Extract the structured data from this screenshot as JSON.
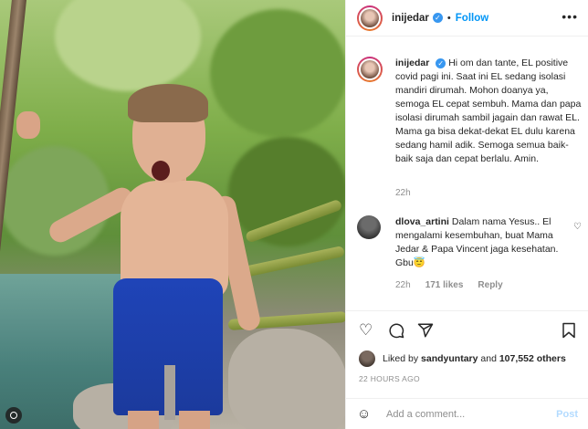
{
  "post": {
    "username": "inijedar",
    "follow_label": "Follow",
    "separator": "•",
    "more_label": "•••",
    "caption_user": "inijedar",
    "caption": "Hi om dan tante, EL positive covid pagi ini. Saat ini EL sedang isolasi mandiri dirumah. Mohon doanya ya, semoga EL cepat sembuh. Mama dan papa isolasi dirumah sambil jagain dan rawat EL. Mama ga bisa dekat-dekat EL dulu karena sedang hamil adik. Semoga semua baik-baik saja dan cepat berlalu. Amin.",
    "caption_time": "22h"
  },
  "comments": [
    {
      "user": "dlova_artini",
      "text": "Dalam nama Yesus.. El mengalami kesembuhan, buat Mama Jedar & Papa Vincent jaga kesehatan. Gbu😇",
      "time": "22h",
      "likes": "171 likes",
      "reply_label": "Reply"
    }
  ],
  "likes": {
    "prefix": "Liked by",
    "user": "sandyuntary",
    "and": "and",
    "count": "107,552 others"
  },
  "posted_ago": "22 HOURS AGO",
  "comment_box": {
    "placeholder": "Add a comment...",
    "post_label": "Post"
  },
  "icons": {
    "heart": "heart-icon",
    "comment": "comment-icon",
    "share": "share-icon",
    "bookmark": "bookmark-icon",
    "emoji": "emoji-icon"
  },
  "colors": {
    "accent": "#0095f6",
    "verified": "#3897f0",
    "muted": "#8e8e8e"
  }
}
